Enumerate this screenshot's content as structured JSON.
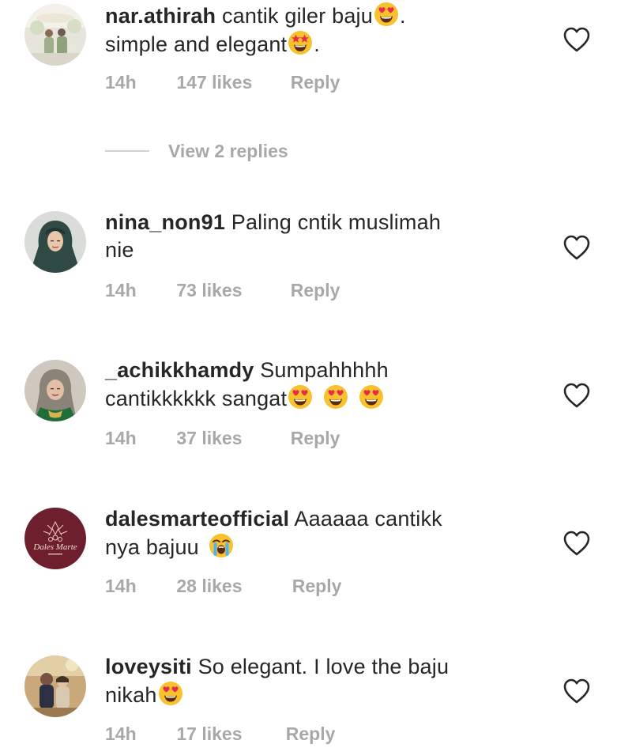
{
  "comments": [
    {
      "username": "nar.athirah",
      "text_parts": [
        "cantik giler baju",
        ".",
        "simple and elegant",
        "."
      ],
      "emojis": [
        "heart-eyes",
        "star-struck"
      ],
      "time": "14h",
      "likes": "147 likes",
      "reply": "Reply",
      "view_replies": "View 2 replies"
    },
    {
      "username": "nina_non91",
      "text_parts": [
        "Paling cntik muslimah",
        "nie"
      ],
      "time": "14h",
      "likes": "73 likes",
      "reply": "Reply"
    },
    {
      "username": "_achikkhamdy",
      "text_parts": [
        "Sumpahhhhh",
        "cantikkkkkk sangat"
      ],
      "emojis": [
        "heart-eyes",
        "heart-eyes",
        "heart-eyes"
      ],
      "time": "14h",
      "likes": "37 likes",
      "reply": "Reply"
    },
    {
      "username": "dalesmarteofficial",
      "text_parts": [
        "Aaaaaa cantikk",
        "nya bajuu"
      ],
      "emojis": [
        "loudly-crying"
      ],
      "avatar_text": "Dales Marte",
      "time": "14h",
      "likes": "28 likes",
      "reply": "Reply"
    },
    {
      "username": "loveysiti",
      "text_parts": [
        "So elegant. I love the baju",
        "nikah"
      ],
      "emojis": [
        "heart-eyes"
      ],
      "time": "14h",
      "likes": "17 likes",
      "reply": "Reply"
    }
  ],
  "colors": {
    "text": "#262626",
    "meta": "#a8a8a8",
    "divider": "#d0d0d0",
    "emoji_face": "#f7c22d",
    "emoji_heart": "#e8294b"
  }
}
